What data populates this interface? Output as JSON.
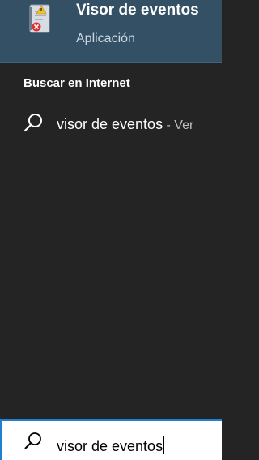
{
  "best_match": {
    "title": "Visor de eventos",
    "subtitle": "Aplicación",
    "icon": "event-viewer-icon"
  },
  "web_section": {
    "header": "Buscar en Internet",
    "result": {
      "query": "visor de eventos",
      "suffix": " - Ver",
      "icon": "search-icon"
    }
  },
  "search_box": {
    "value": "visor de eventos",
    "icon": "search-icon"
  },
  "colors": {
    "panel_bg": "#242424",
    "selected_bg": "#345064",
    "search_border": "#1f7fd0"
  }
}
